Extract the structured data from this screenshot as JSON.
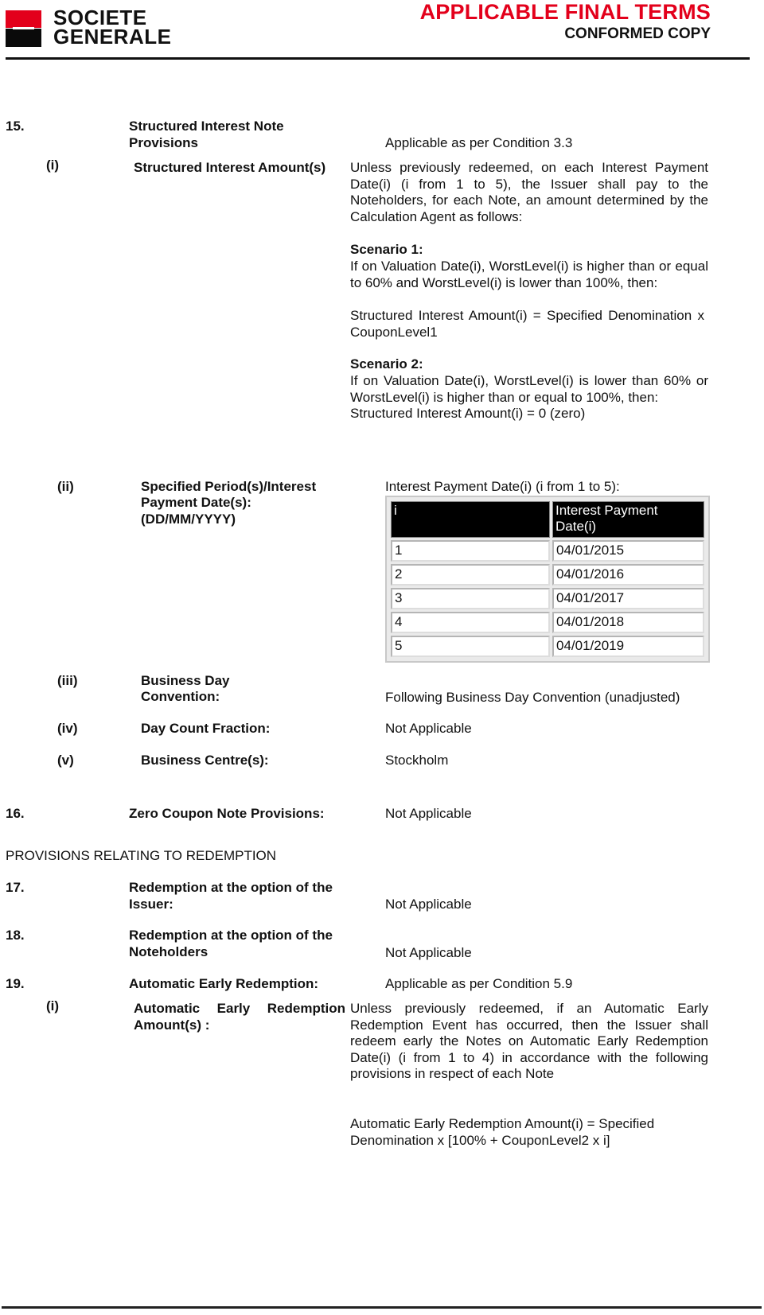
{
  "header": {
    "logo_line1": "SOCIETE",
    "logo_line2": "GENERALE",
    "title": "APPLICABLE FINAL TERMS",
    "subtitle": "CONFORMED COPY",
    "brand_red": "#e3001b",
    "brand_black": "#0a0a0a"
  },
  "sections": {
    "s15": {
      "number": "15.",
      "label": "Structured Interest Note Provisions",
      "label_line1": "Structured Interest Note",
      "label_line2": "Provisions",
      "value": "Applicable as per Condition 3.3",
      "i": {
        "marker": "(i)",
        "label": "Structured Interest Amount(s)",
        "intro": "Unless previously redeemed, on each Interest Payment Date(i) (i from 1 to 5), the Issuer shall pay to the Noteholders, for each Note, an amount determined by the Calculation Agent as follows:",
        "scenario1_title": "Scenario 1:",
        "scenario1_text": "If on Valuation Date(i), WorstLevel(i) is higher than or equal to 60% and WorstLevel(i) is lower than 100%, then:",
        "scenario1_formula": "Structured Interest Amount(i) = Specified Denomination x CouponLevel1",
        "scenario2_title": "Scenario 2:",
        "scenario2_text": "If on Valuation Date(i), WorstLevel(i) is lower than 60% or WorstLevel(i) is higher than or equal to 100%, then:",
        "scenario2_formula": "Structured Interest Amount(i) = 0 (zero)"
      },
      "ii": {
        "marker": "(ii)",
        "label_line1": "Specified Period(s)/Interest",
        "label_line2": "Payment Date(s):",
        "label_line3": "(DD/MM/YYYY)",
        "caption": "Interest Payment Date(i) (i from 1 to 5):",
        "table": {
          "headers": [
            "i",
            "Interest Payment Date(i)"
          ],
          "rows": [
            [
              "1",
              "04/01/2015"
            ],
            [
              "2",
              "04/01/2016"
            ],
            [
              "3",
              "04/01/2017"
            ],
            [
              "4",
              "04/01/2018"
            ],
            [
              "5",
              "04/01/2019"
            ]
          ]
        }
      },
      "iii": {
        "marker": "(iii)",
        "label_line1": "Business Day",
        "label_line2": "Convention:",
        "value": "Following Business Day Convention (unadjusted)"
      },
      "iv": {
        "marker": "(iv)",
        "label": "Day Count Fraction:",
        "value": "Not Applicable"
      },
      "v": {
        "marker": "(v)",
        "label": "Business Centre(s):",
        "value": "Stockholm"
      }
    },
    "s16": {
      "number": "16.",
      "label": "Zero Coupon Note Provisions:",
      "value": "Not Applicable"
    },
    "redemption_heading": "PROVISIONS RELATING TO REDEMPTION",
    "s17": {
      "number": "17.",
      "label_line1": "Redemption at the option of the",
      "label_line2": "Issuer:",
      "value": "Not Applicable"
    },
    "s18": {
      "number": "18.",
      "label_line1": "Redemption at the option of the",
      "label_line2": "Noteholders",
      "value": "Not Applicable"
    },
    "s19": {
      "number": "19.",
      "label": "Automatic Early Redemption:",
      "value": "Applicable as per Condition 5.9",
      "i": {
        "marker": "(i)",
        "label_line1": "Automatic Early Redemption",
        "label_line2": "Amount(s) :",
        "text": "Unless previously redeemed, if an Automatic Early Redemption Event has occurred, then the Issuer shall redeem early the Notes on Automatic Early Redemption Date(i) (i from 1 to 4) in accordance with the following provisions in respect of each Note",
        "formula": "Automatic Early Redemption Amount(i) = Specified Denomination x [100% + CouponLevel2 x i]"
      }
    }
  }
}
